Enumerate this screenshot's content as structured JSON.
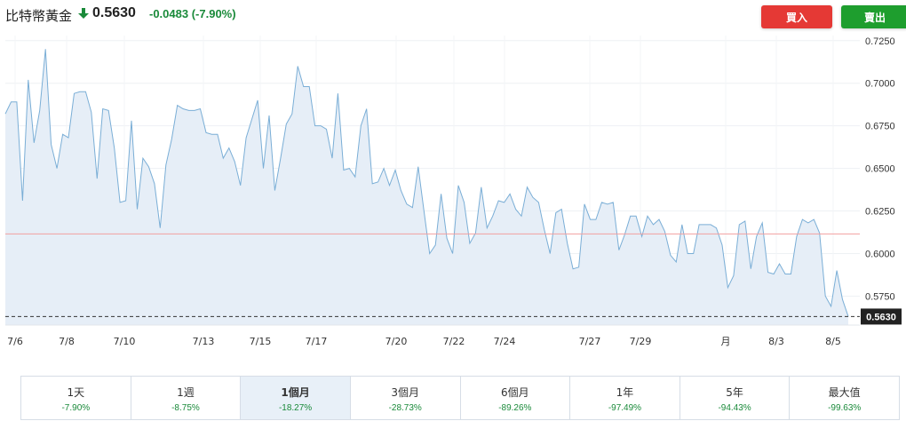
{
  "header": {
    "asset_name": "比特幣黃金",
    "price": "0.5630",
    "change": "-0.0483",
    "change_pct": "(-7.90%)",
    "direction": "down"
  },
  "actions": {
    "buy_label": "買入",
    "sell_label": "賣出"
  },
  "colors": {
    "up": "#1e9e2e",
    "down": "#1a8a3a",
    "buy": "#e53935",
    "sell": "#1e9e2e",
    "line": "#7aaed6",
    "area": "#e6eef7",
    "reference_line": "#f2a0a0"
  },
  "chart_data": {
    "type": "area",
    "ylim": [
      0.558,
      0.728
    ],
    "y_ticks": [
      "0.7250",
      "0.7000",
      "0.6750",
      "0.6500",
      "0.6250",
      "0.6000",
      "0.5750"
    ],
    "x_ticks": [
      "7/6",
      "7/8",
      "7/10",
      "7/13",
      "7/15",
      "7/17",
      "7/20",
      "7/22",
      "7/24",
      "7/27",
      "7/29",
      "月",
      "8/3",
      "8/5"
    ],
    "reference_value": 0.6115,
    "current_value": 0.563,
    "current_label": "0.5630",
    "grid": true,
    "series": [
      {
        "values": [
          0.682,
          0.689,
          0.689,
          0.631,
          0.702,
          0.665,
          0.684,
          0.72,
          0.664,
          0.65,
          0.67,
          0.668,
          0.694,
          0.695,
          0.695,
          0.683,
          0.644,
          0.685,
          0.684,
          0.662,
          0.63,
          0.631,
          0.678,
          0.626,
          0.656,
          0.651,
          0.641,
          0.615,
          0.652,
          0.667,
          0.687,
          0.685,
          0.684,
          0.684,
          0.685,
          0.671,
          0.67,
          0.67,
          0.656,
          0.662,
          0.654,
          0.64,
          0.668,
          0.679,
          0.69,
          0.65,
          0.681,
          0.637,
          0.656,
          0.676,
          0.682,
          0.71,
          0.698,
          0.698,
          0.675,
          0.675,
          0.673,
          0.656,
          0.694,
          0.649,
          0.65,
          0.645,
          0.675,
          0.685,
          0.641,
          0.642,
          0.65,
          0.64,
          0.649,
          0.637,
          0.629,
          0.627,
          0.651,
          0.625,
          0.6,
          0.605,
          0.635,
          0.609,
          0.6,
          0.64,
          0.63,
          0.606,
          0.612,
          0.639,
          0.615,
          0.622,
          0.631,
          0.63,
          0.635,
          0.626,
          0.622,
          0.639,
          0.633,
          0.63,
          0.614,
          0.6,
          0.624,
          0.626,
          0.606,
          0.591,
          0.592,
          0.629,
          0.62,
          0.62,
          0.63,
          0.629,
          0.63,
          0.602,
          0.611,
          0.622,
          0.622,
          0.61,
          0.622,
          0.617,
          0.62,
          0.613,
          0.599,
          0.595,
          0.617,
          0.6,
          0.6,
          0.617,
          0.617,
          0.617,
          0.615,
          0.605,
          0.58,
          0.587,
          0.617,
          0.619,
          0.591,
          0.61,
          0.618,
          0.589,
          0.588,
          0.594,
          0.588,
          0.588,
          0.61,
          0.62,
          0.618,
          0.62,
          0.612,
          0.575,
          0.569,
          0.59,
          0.573,
          0.563
        ]
      }
    ]
  },
  "periods": [
    {
      "label": "1天",
      "change": "-7.90%"
    },
    {
      "label": "1週",
      "change": "-8.75%"
    },
    {
      "label": "1個月",
      "change": "-18.27%",
      "active": true
    },
    {
      "label": "3個月",
      "change": "-28.73%"
    },
    {
      "label": "6個月",
      "change": "-89.26%"
    },
    {
      "label": "1年",
      "change": "-97.49%"
    },
    {
      "label": "5年",
      "change": "-94.43%"
    },
    {
      "label": "最大值",
      "change": "-99.63%"
    }
  ]
}
